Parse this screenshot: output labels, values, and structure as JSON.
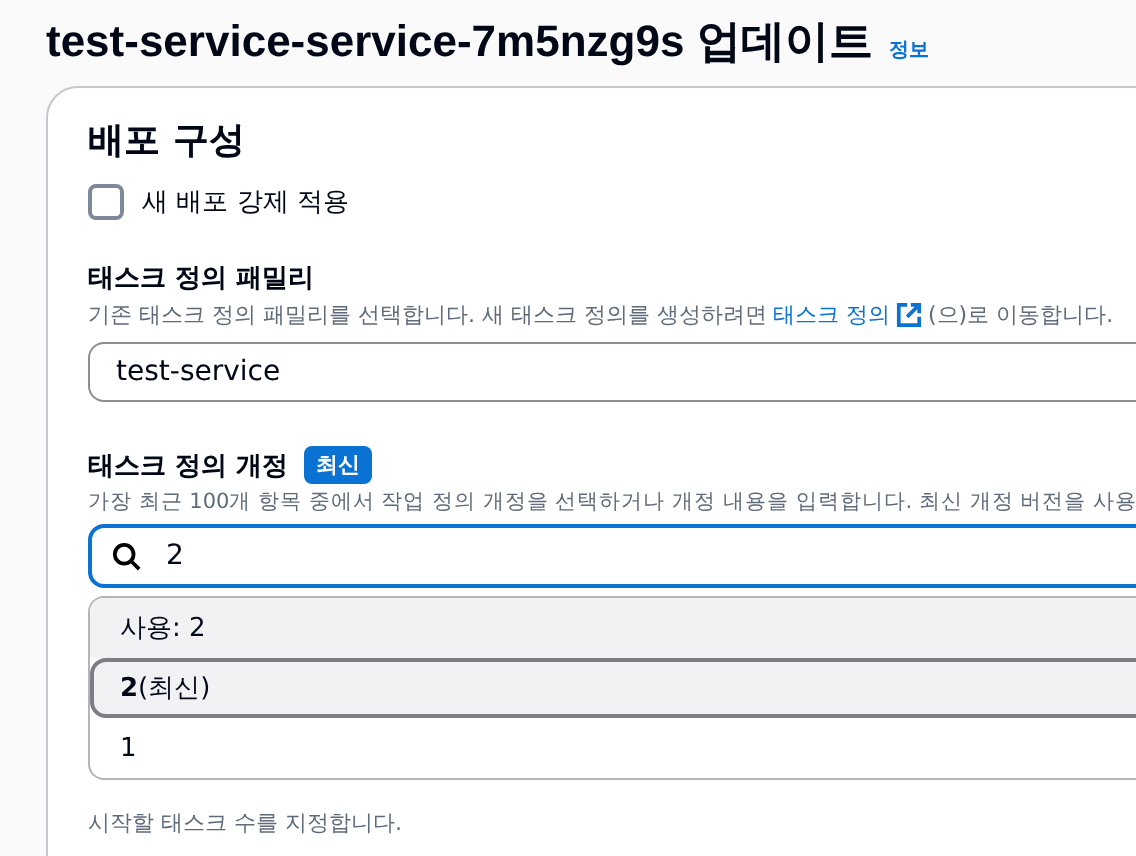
{
  "page": {
    "title": "test-service-service-7m5nzg9s 업데이트",
    "info_link": "정보"
  },
  "section": {
    "title": "배포 구성",
    "force_deploy": {
      "label": "새 배포 강제 적용",
      "checked": false
    },
    "family": {
      "label": "태스크 정의 패밀리",
      "description_before": "기존 태스크 정의 패밀리를 선택합니다. 새 태스크 정의를 생성하려면",
      "description_link": "태스크 정의",
      "description_after": "(으)로 이동합니다.",
      "value": "test-service"
    },
    "revision": {
      "label": "태스크 정의 개정",
      "badge": "최신",
      "description": "가장 최근 100개 항목 중에서 작업 정의 개정을 선택하거나 개정 내용을 입력합니다. 최신 개정 버전을 사용",
      "value": "2",
      "options": [
        {
          "label": "사용: 2",
          "selected": false
        },
        {
          "label": "**2**(최신)",
          "selected": true
        },
        {
          "label": "1",
          "selected": false
        }
      ]
    },
    "desired_tasks": {
      "description": "시작할 태스크 수를 지정합니다."
    }
  }
}
